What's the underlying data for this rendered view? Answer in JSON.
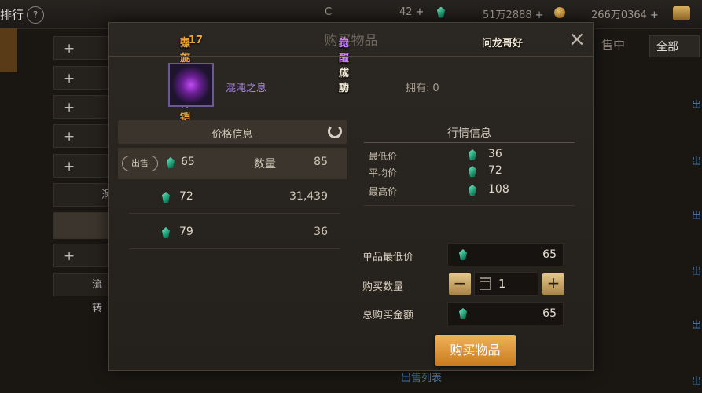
{
  "background": {
    "title": "排行",
    "help": "?",
    "currency": {
      "c_value": "42",
      "gem_value": "51万2888",
      "coin_value": "266万0364"
    },
    "sidebar_buttons": [
      "+",
      "+",
      "+",
      "+",
      "+",
      "",
      "",
      "+",
      ""
    ],
    "sidebar_texts": [
      "",
      "",
      "",
      "",
      "",
      "涡",
      "",
      "",
      "流转"
    ],
    "right_tab": "售中",
    "right_all": "全部",
    "right_links": [
      "出",
      "出",
      "出",
      "出",
      "出",
      "出",
      "出",
      "出"
    ],
    "bottom_link": "出售列表"
  },
  "modal": {
    "title": "购买物品",
    "ticker": [
      "强化了",
      "螺旋陨星背铠",
      "+17",
      "络马化腾",
      "个面成功",
      "觉醒",
      "问龙哥好"
    ],
    "close": "×",
    "item_name": "混沌之息",
    "owned_label": "拥有:",
    "owned_value": "0",
    "price_header": "价格信息",
    "rows": [
      {
        "badge": "出售",
        "price": "65",
        "qty_label": "数量",
        "qty": "85"
      },
      {
        "price": "72",
        "qty": "31,439"
      },
      {
        "price": "79",
        "qty": "36"
      }
    ],
    "market": {
      "title": "行情信息",
      "min_label": "最低价",
      "min_value": "36",
      "avg_label": "平均价",
      "avg_value": "72",
      "max_label": "最高价",
      "max_value": "108"
    },
    "form": {
      "unit_price_label": "单品最低价",
      "unit_price": "65",
      "qty_label": "购买数量",
      "qty": "1",
      "minus": "−",
      "plus": "+",
      "total_label": "总购买金额",
      "total": "65"
    },
    "buy_button": "购买物品"
  },
  "colors": {
    "accent": "#e49a34",
    "gem": "#2ec99a",
    "item_purple": "#b08be0"
  }
}
